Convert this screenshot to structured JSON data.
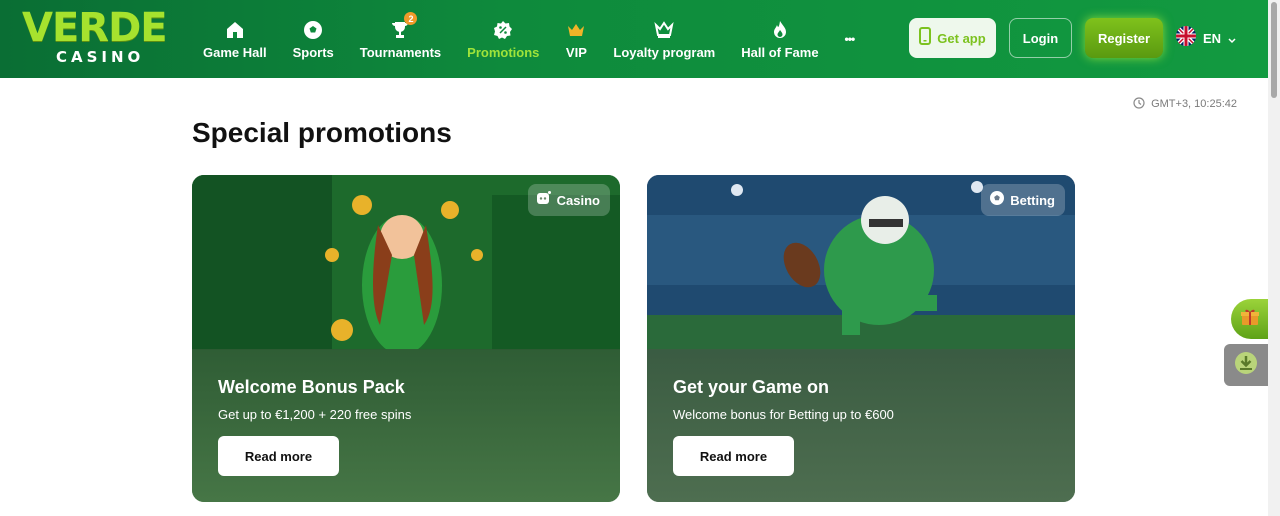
{
  "brand": {
    "name": "VERDE",
    "sub": "CASINO"
  },
  "nav": [
    {
      "label": "Game Hall",
      "icon": "home-icon"
    },
    {
      "label": "Sports",
      "icon": "soccer-ball-icon"
    },
    {
      "label": "Tournaments",
      "icon": "trophy-icon",
      "badge": "2"
    },
    {
      "label": "Promotions",
      "icon": "percent-badge-icon",
      "active": true
    },
    {
      "label": "VIP",
      "icon": "crown-icon"
    },
    {
      "label": "Loyalty program",
      "icon": "crown-outline-icon"
    },
    {
      "label": "Hall of Fame",
      "icon": "flame-icon"
    },
    {
      "label": "•••",
      "icon": "more-icon"
    }
  ],
  "header": {
    "get_app": "Get app",
    "login": "Login",
    "register": "Register",
    "lang": "EN"
  },
  "time": {
    "label": "GMT+3,  10:25:42"
  },
  "page": {
    "title": "Special promotions"
  },
  "cards": [
    {
      "tag": "Casino",
      "title": "Welcome Bonus Pack",
      "desc": "Get up to €1,200 + 220 free spins",
      "cta": "Read more"
    },
    {
      "tag": "Betting",
      "title": "Get your Game on",
      "desc": "Welcome bonus for Betting up to €600",
      "cta": "Read more"
    }
  ],
  "colors": {
    "header_green": "#0e8a3c",
    "accent_lime": "#9fe33a",
    "register": "#6fb217"
  }
}
